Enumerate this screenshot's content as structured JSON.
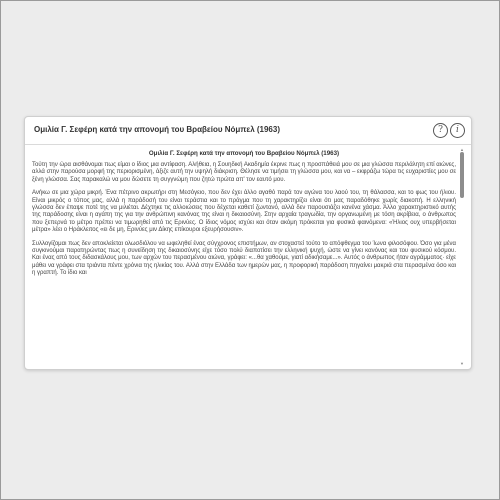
{
  "window": {
    "title": "Ομιλία Γ. Σεφέρη κατά την απονομή του Βραβείου Νόμπελ (1963)",
    "help_icon": "?",
    "info_icon": "i"
  },
  "document": {
    "heading": "Ομιλία Γ. Σεφέρη κατά την απονομή του Βραβείου Νόμπελ (1963)",
    "paragraphs": [
      "Τούτη την ώρα αισθάνομαι πως είμαι ο ίδιος μια αντίφαση. Αλήθεια, η Σουηδική Ακαδημία έκρινε πως η προσπάθειά μου σε μια γλώσσα περιλάλητη επί αιώνες, αλλά στην παρούσα μορφή της περιορισμένη, άξιζε αυτή την υψηλή διάκριση. Θέλησε να τιμήσει τη γλώσσα μου, και να – εκφράζω τώρα τις ευχαριστίες μου σε ξένη γλώσσα. Σας παρακαλώ να μου δώσετε τη συγγνώμη που ζητώ πρώτα απ' τον εαυτό μου.",
      "Ανήκω σε μια χώρα μικρή. Ένα πέτρινο ακρωτήρι στη Μεσόγειο, που δεν έχει άλλο αγαθό παρά τον αγώνα του λαού του, τη θάλασσα, και το φως του ήλιου. Είναι μικρός ο τόπος μας, αλλά η παράδοσή του είναι τεράστια και το πράγμα που τη χαρακτηρίζει είναι ότι μας παραδόθηκε χωρίς διακοπή. Η ελληνική γλώσσα δεν έπαψε ποτέ της να μιλιέται. Δέχτηκε τις αλλοιώσεις που δέχεται καθετί ζωντανό, αλλά δεν παρουσιάζει κανένα χάσμα. Άλλο χαρακτηριστικό αυτής της παράδοσης είναι η αγάπη της για την ανθρώπινη κανόνας της είναι η δικαιοσύνη. Στην αρχαία τραγωδία, την οργανωμένη με τόση ακρίβεια, ο άνθρωπος που ξεπερνά το μέτρο πρέπει να τιμωρηθεί από τις Ερινύες. Ο ίδιος νόμος ισχύει και όταν ακόμη πρόκειται για φυσικά φαινόμενα: «Ήλιος ουχ υπερβήσεται μέτρα» λέει ο Ηράκλειτος «ει δε μη, Ερινύες μιν Δίκης επίκουροι εξευρήσουσιν».",
      "Συλλογίζομαι πως δεν αποκλείεται ολωσδιόλου να ωφεληθεί ένας σύγχρονος επιστήμων, αν στοχαστεί τούτο το απόφθεγμα του Ίωνα φιλοσόφου. Όσο για μένα συγκινούμαι παρατηρώντας πως η συνείδηση της δικαιοσύνης είχε τόσο πολύ διαποτίσει την ελληνική ψυχή, ώστε να γίνει κανόνας και του φυσικού κόσμου. Και ένας από τους διδασκάλους μου, των αρχών του περασμένου αιώνα, γράφει: «...θα χαθούμε, γιατί αδικήσαμε...». Αυτός ο άνθρωπος ήταν αγράμματος· είχε μάθει να γράφει στα τριάντα πέντε χρόνια της ηλικίας του. Αλλά στην Ελλάδα των ημερών μας, η προφορική παράδοση πηγαίνει μακριά στα περασμένα όσο και η γραπτή. Το ίδιο και"
    ]
  },
  "colors": {
    "accent_text": "#333333",
    "body_text": "#444444",
    "background": "#ececec",
    "panel": "#ffffff"
  },
  "icons": [
    "help-icon",
    "info-icon"
  ]
}
